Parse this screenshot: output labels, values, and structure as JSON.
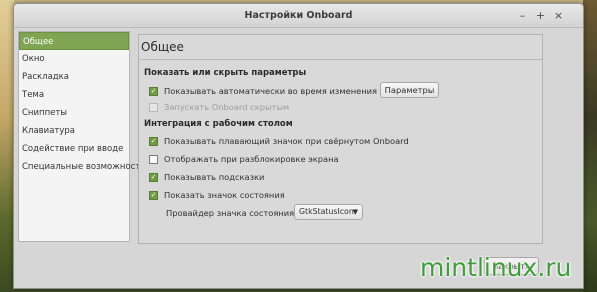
{
  "window": {
    "title": "Настройки Onboard",
    "controls": {
      "minimize": "–",
      "maximize": "+",
      "close": "×"
    }
  },
  "sidebar": {
    "items": [
      {
        "label": "Общее",
        "active": true
      },
      {
        "label": "Окно",
        "active": false
      },
      {
        "label": "Раскладка",
        "active": false
      },
      {
        "label": "Тема",
        "active": false
      },
      {
        "label": "Сниппеты",
        "active": false
      },
      {
        "label": "Клавиатура",
        "active": false
      },
      {
        "label": "Содействие при вводе",
        "active": false
      },
      {
        "label": "Специальные возможности",
        "active": false
      }
    ]
  },
  "main": {
    "title": "Общее",
    "show_hide_section": {
      "heading": "Показать или скрыть параметры",
      "auto_show": {
        "label": "Показывать автоматически во время изменения текста",
        "checked": true,
        "enabled": true
      },
      "start_hidden": {
        "label": "Запускать Onboard скрытым",
        "checked": false,
        "enabled": false
      },
      "params_button": "Параметры"
    },
    "desktop_section": {
      "heading": "Интеграция с рабочим столом",
      "floating_icon": {
        "label": "Показывать плавающий значок при свёрнутом Onboard",
        "checked": true
      },
      "show_on_unlock": {
        "label": "Отображать при разблокировке экрана",
        "checked": false
      },
      "show_tooltips": {
        "label": "Показывать подсказки",
        "checked": true
      },
      "show_status_icon": {
        "label": "Показать значок состояния",
        "checked": true
      },
      "provider_label": "Провайдер значка состояния:",
      "provider_value": "GtkStatusIcon"
    }
  },
  "footer": {
    "close_button": "Закрыть"
  },
  "watermark": "mintlinux.ru",
  "colors": {
    "accent": "#7fa553",
    "checkbox_on": "#6f9d3f",
    "watermark": "#3f9d3a"
  }
}
